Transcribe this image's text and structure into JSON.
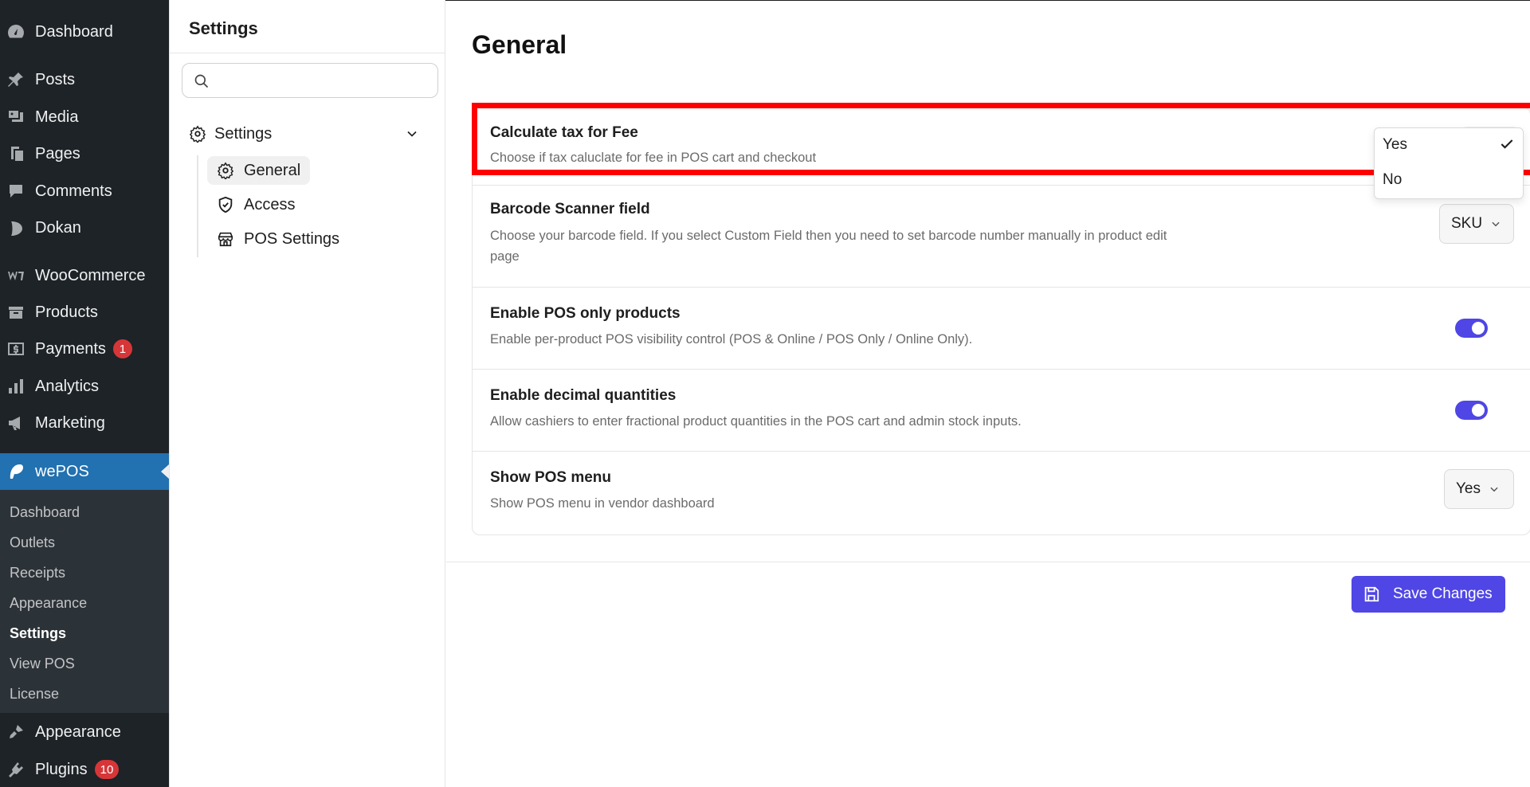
{
  "wp_sidebar": {
    "items": [
      {
        "label": "Dashboard",
        "icon": "dashboard-icon"
      },
      {
        "label": "Posts",
        "icon": "pin-icon"
      },
      {
        "label": "Media",
        "icon": "media-icon"
      },
      {
        "label": "Pages",
        "icon": "pages-icon"
      },
      {
        "label": "Comments",
        "icon": "comment-icon"
      },
      {
        "label": "Dokan",
        "icon": "dokan-icon"
      },
      {
        "label": "WooCommerce",
        "icon": "woocommerce-icon"
      },
      {
        "label": "Products",
        "icon": "archive-icon"
      },
      {
        "label": "Payments",
        "icon": "dollar-icon",
        "badge": "1"
      },
      {
        "label": "Analytics",
        "icon": "bar-chart-icon"
      },
      {
        "label": "Marketing",
        "icon": "megaphone-icon"
      }
    ],
    "active": {
      "label": "wePOS",
      "icon": "wepos-icon"
    },
    "submenu": [
      "Dashboard",
      "Outlets",
      "Receipts",
      "Appearance",
      "Settings",
      "View POS",
      "License"
    ],
    "submenu_current": "Settings",
    "bottom_items": [
      {
        "label": "Appearance",
        "icon": "brush-icon"
      },
      {
        "label": "Plugins",
        "icon": "plug-icon",
        "badge": "10"
      }
    ]
  },
  "settings_nav": {
    "title": "Settings",
    "search_placeholder": "",
    "group_label": "Settings",
    "children": [
      {
        "label": "General",
        "icon": "gear-icon",
        "active": true
      },
      {
        "label": "Access",
        "icon": "shield-icon"
      },
      {
        "label": "POS Settings",
        "icon": "store-icon"
      }
    ]
  },
  "main": {
    "title": "General",
    "rows": [
      {
        "title": "Calculate tax for Fee",
        "desc": "Choose if tax caluclate for fee in POS cart and checkout"
      },
      {
        "title": "Barcode Scanner field",
        "desc": "Choose your barcode field. If you select Custom Field then you need to set barcode number manually in product edit page",
        "control_value": "SKU"
      },
      {
        "title": "Enable POS only products",
        "desc": "Enable per-product POS visibility control (POS & Online / POS Only / Online Only).",
        "toggle_on": true
      },
      {
        "title": "Enable decimal quantities",
        "desc": "Allow cashiers to enter fractional product quantities in the POS cart and admin stock inputs.",
        "toggle_on": true
      },
      {
        "title": "Show POS menu",
        "desc": "Show POS menu in vendor dashboard",
        "control_value": "Yes"
      }
    ],
    "dropdown": {
      "options": [
        "Yes",
        "No"
      ],
      "selected": "Yes"
    },
    "save_label": "Save Changes"
  },
  "colors": {
    "accent": "#4f46e5",
    "wp_sidebar_bg": "#1d2327",
    "wp_active": "#2271b1",
    "highlight": "#ff0000",
    "badge": "#d63638"
  }
}
